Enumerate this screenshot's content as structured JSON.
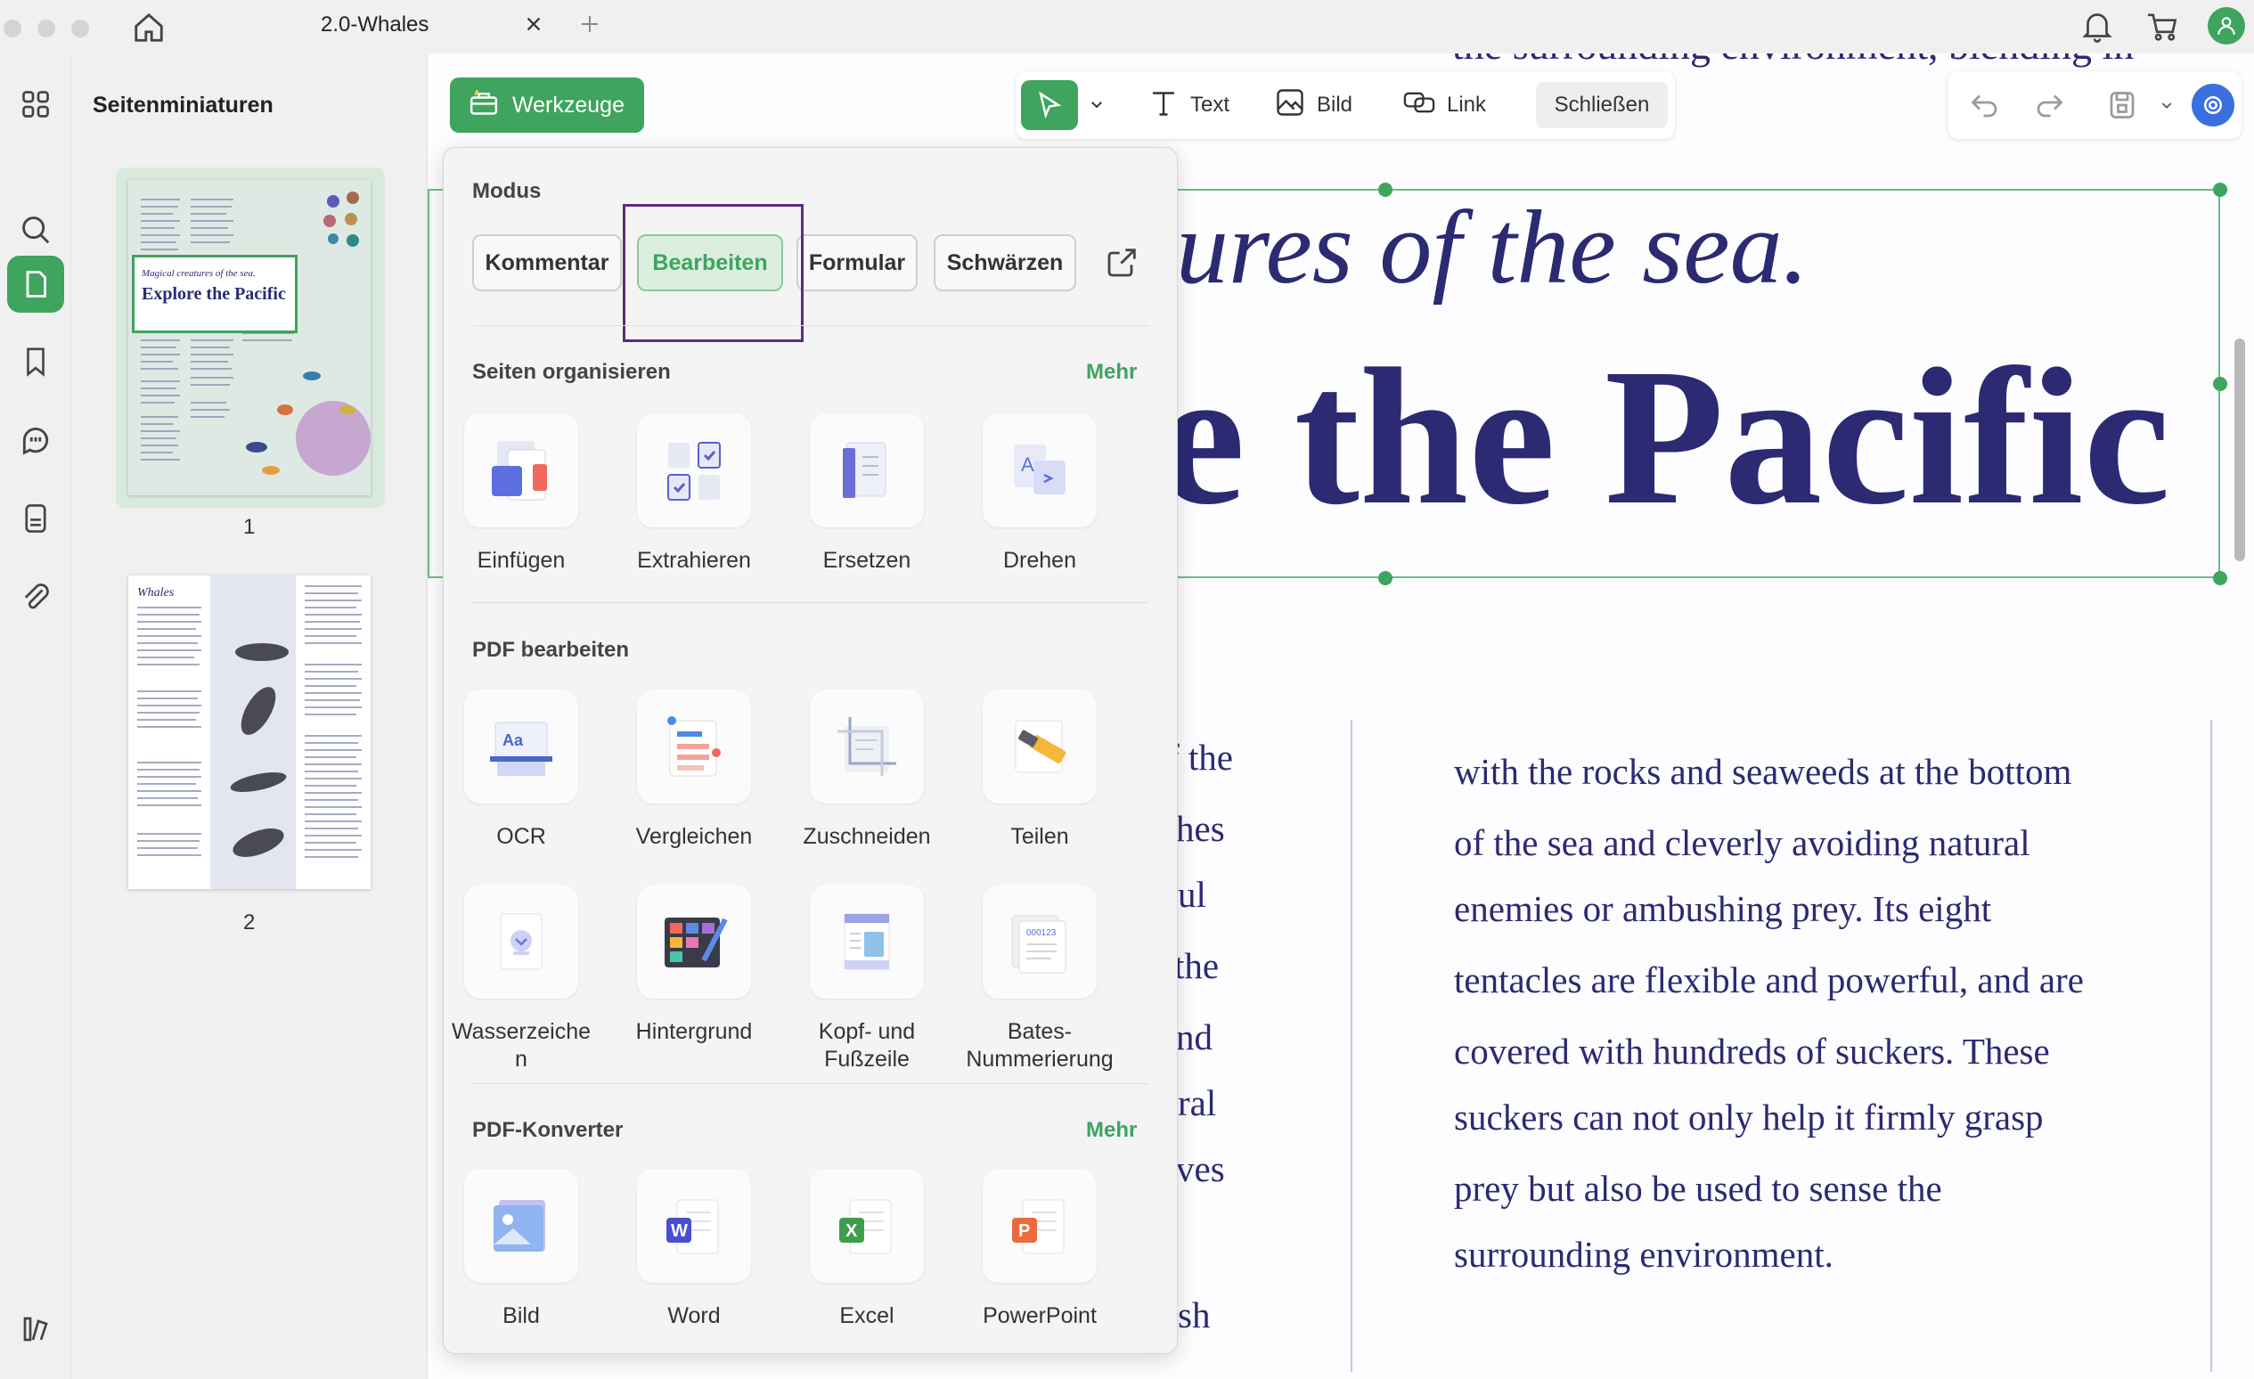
{
  "titlebar": {
    "tab_title": "2.0-Whales",
    "close_tab_icon": "close-icon",
    "new_tab_icon": "plus-icon"
  },
  "sidebar_panel": {
    "title": "Seitenminiaturen",
    "pages": [
      {
        "number": "1",
        "thumb_subtitle": "Magical creatures of the sea.",
        "thumb_title": "Explore the Pacific"
      },
      {
        "number": "2",
        "thumb_title": "Whales"
      }
    ]
  },
  "toolbar": {
    "werkzeuge": "Werkzeuge",
    "text": "Text",
    "bild": "Bild",
    "link": "Link",
    "schliessen": "Schließen"
  },
  "tools_panel": {
    "modus": {
      "title": "Modus",
      "buttons": [
        "Kommentar",
        "Bearbeiten",
        "Formular",
        "Schwärzen"
      ],
      "active": "Bearbeiten"
    },
    "seiten_organisieren": {
      "title": "Seiten organisieren",
      "more": "Mehr",
      "items": [
        "Einfügen",
        "Extrahieren",
        "Ersetzen",
        "Drehen"
      ]
    },
    "pdf_bearbeiten": {
      "title": "PDF bearbeiten",
      "items": [
        "OCR",
        "Vergleichen",
        "Zuschneiden",
        "Teilen",
        "Wasserzeiche\nn",
        "Hintergrund",
        "Kopf- und\nFußzeile",
        "Bates-\nNummerierung"
      ]
    },
    "pdf_konverter": {
      "title": "PDF-Konverter",
      "more": "Mehr",
      "items": [
        "Bild",
        "Word",
        "Excel",
        "PowerPoint"
      ]
    }
  },
  "document": {
    "top_cut_text": "the surrounding environment, blending in",
    "heading_italic": "ures of the sea.",
    "heading_bold": "e the Pacific",
    "left_col_fragments": [
      "f the",
      "hes",
      "ul",
      " the",
      "nd",
      "ral",
      "ves",
      "sh"
    ],
    "right_col_lines": [
      "with the rocks and seaweeds at the bottom",
      "of the sea and cleverly avoiding natural",
      "enemies or ambushing prey. Its eight",
      "tentacles are flexible and powerful, and are",
      "covered with hundreds of suckers. These",
      "suckers can not only help it firmly grasp",
      "prey but also be used to sense the",
      "surrounding environment."
    ]
  },
  "colors": {
    "accent": "#3ea45e",
    "text_navy": "#2b2a72",
    "highlight": "#5b2c7a"
  }
}
